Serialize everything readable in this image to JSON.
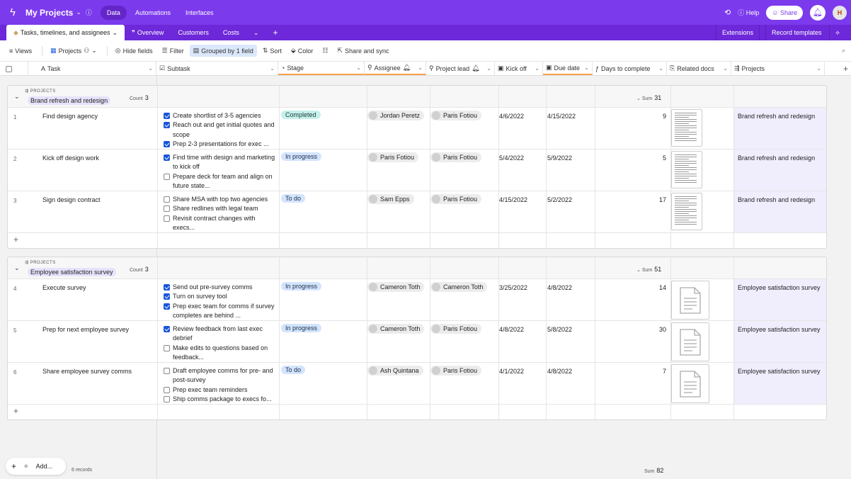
{
  "topbar": {
    "app_title": "My Projects",
    "nav": [
      "Data",
      "Automations",
      "Interfaces"
    ],
    "help": "Help",
    "share": "Share",
    "avatar": "H"
  },
  "tabs": {
    "active": "Tasks, timelines, and assignees",
    "others": [
      "Overview",
      "Customers",
      "Costs"
    ],
    "extensions": "Extensions",
    "record_templates": "Record templates"
  },
  "toolbar": {
    "views": "Views",
    "view_name": "Projects",
    "hide_fields": "Hide fields",
    "filter": "Filter",
    "grouped": "Grouped by 1 field",
    "sort": "Sort",
    "color": "Color",
    "share_sync": "Share and sync"
  },
  "columns": [
    "Task",
    "Subtask",
    "Stage",
    "Assignee",
    "Project lead",
    "Kick off",
    "Due date",
    "Days to complete",
    "Related docs",
    "Projects"
  ],
  "groups": [
    {
      "field": "PROJECTS",
      "value": "Brand refresh and redesign",
      "count_label": "Count",
      "count": "3",
      "sum_label": "Sum",
      "sum": "31",
      "rows": [
        {
          "num": "1",
          "task": "Find design agency",
          "subtasks": [
            {
              "t": "Create shortlist of 3-5 agencies",
              "c": true
            },
            {
              "t": "Reach out and get initial quotes and scope",
              "c": true
            },
            {
              "t": "Prep 2-3 presentations for exec ...",
              "c": true
            }
          ],
          "stage": "Completed",
          "stage_color": "#c5f0ec",
          "assignee": "Jordan Peretz",
          "lead": "Paris Fotiou",
          "kick": "4/6/2022",
          "due": "4/15/2022",
          "days": "9",
          "doc": "page",
          "project": "Brand refresh and redesign"
        },
        {
          "num": "2",
          "task": "Kick off design work",
          "subtasks": [
            {
              "t": "Find time with design and marketing to kick off",
              "c": true
            },
            {
              "t": "Prepare deck for team and align on future state...",
              "c": false
            }
          ],
          "stage": "In progress",
          "stage_color": "#d3e4fd",
          "assignee": "Paris Fotiou",
          "lead": "Paris Fotiou",
          "kick": "5/4/2022",
          "due": "5/9/2022",
          "days": "5",
          "doc": "page",
          "project": "Brand refresh and redesign"
        },
        {
          "num": "3",
          "task": "Sign design contract",
          "subtasks": [
            {
              "t": "Share MSA with top two agencies",
              "c": false
            },
            {
              "t": "Share redlines with legal team",
              "c": false
            },
            {
              "t": "Revisit contract changes with execs...",
              "c": false
            }
          ],
          "stage": "To do",
          "stage_color": "#d3e4fd",
          "assignee": "Sam Epps",
          "lead": "Paris Fotiou",
          "kick": "4/15/2022",
          "due": "5/2/2022",
          "days": "17",
          "doc": "page",
          "project": "Brand refresh and redesign"
        }
      ]
    },
    {
      "field": "PROJECTS",
      "value": "Employee satisfaction survey",
      "count_label": "Count",
      "count": "3",
      "sum_label": "Sum",
      "sum": "51",
      "rows": [
        {
          "num": "4",
          "task": "Execute survey",
          "subtasks": [
            {
              "t": "Send out pre-survey comms",
              "c": true
            },
            {
              "t": "Turn on survey tool",
              "c": true
            },
            {
              "t": "Prep exec team for comms if survey completes are behind ...",
              "c": true
            }
          ],
          "stage": "In progress",
          "stage_color": "#d3e4fd",
          "assignee": "Cameron Toth",
          "lead": "Cameron Toth",
          "kick": "3/25/2022",
          "due": "4/8/2022",
          "days": "14",
          "doc": "file",
          "project": "Employee satisfaction survey"
        },
        {
          "num": "5",
          "task": "Prep for next employee survey",
          "subtasks": [
            {
              "t": "Review feedback from last exec debrief",
              "c": true
            },
            {
              "t": "Make edits to questions based on feedback...",
              "c": false
            }
          ],
          "stage": "In progress",
          "stage_color": "#d3e4fd",
          "assignee": "Cameron Toth",
          "lead": "Paris Fotiou",
          "kick": "4/8/2022",
          "due": "5/8/2022",
          "days": "30",
          "doc": "file",
          "project": "Employee satisfaction survey"
        },
        {
          "num": "6",
          "task": "Share employee survey comms",
          "subtasks": [
            {
              "t": "Draft employee comms for pre- and post-survey",
              "c": false
            },
            {
              "t": "Prep exec team reminders",
              "c": false
            },
            {
              "t": "Ship comms package to execs fo...",
              "c": false
            }
          ],
          "stage": "To do",
          "stage_color": "#d3e4fd",
          "assignee": "Ash Quintana",
          "lead": "Paris Fotiou",
          "kick": "4/1/2022",
          "due": "4/8/2022",
          "days": "7",
          "doc": "file",
          "project": "Employee satisfaction survey"
        }
      ]
    }
  ],
  "footer": {
    "add": "Add...",
    "records": "6 records",
    "sum_label": "Sum",
    "sum": "82"
  }
}
